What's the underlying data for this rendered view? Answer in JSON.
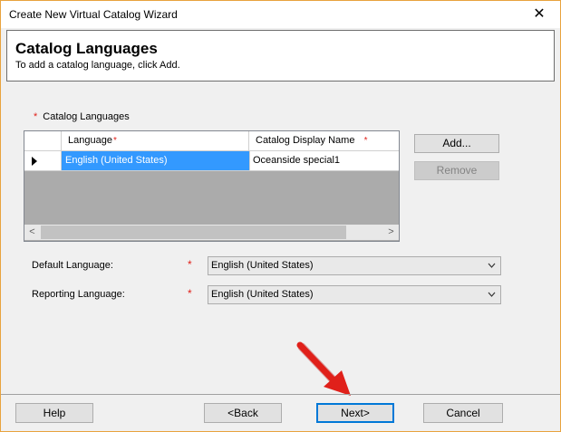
{
  "window": {
    "title": "Create New Virtual Catalog Wizard",
    "close_glyph": "✕"
  },
  "header": {
    "title": "Catalog Languages",
    "subtitle": "To add a catalog language, click Add."
  },
  "required_mark": "*",
  "languages_section": {
    "label": "Catalog Languages",
    "columns": [
      "Language",
      "Catalog Display Name"
    ],
    "rows": [
      {
        "language": "English (United States)",
        "display_name": "Oceanside special1",
        "selected": true
      }
    ],
    "scroll_left": "<",
    "scroll_right": ">"
  },
  "buttons": {
    "add": "Add...",
    "remove": "Remove",
    "help": "Help",
    "back": "<Back",
    "next": "Next>",
    "cancel": "Cancel"
  },
  "fields": {
    "default_language": {
      "label": "Default Language:",
      "value": "English (United States)"
    },
    "reporting_language": {
      "label": "Reporting Language:",
      "value": "English (United States)"
    }
  },
  "icons": {
    "close": "close-icon",
    "row_pointer": "row-pointer-icon",
    "dropdown": "chevron-down-icon",
    "annotation_arrow": "red-arrow-annotation"
  },
  "colors": {
    "accent_border": "#e8a33e",
    "selection": "#3399ff",
    "required": "#e0201a",
    "annotation": "#e0201a"
  }
}
